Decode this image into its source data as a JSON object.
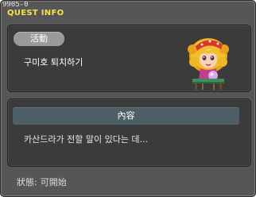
{
  "header": {
    "quest_id": "9905-0",
    "title": "QUEST INFO"
  },
  "quest": {
    "category_label": "活動",
    "name": "구미호 퇴치하기"
  },
  "content": {
    "section_label": "內容",
    "description": "카산드라가 전할 말이 있다는 데..."
  },
  "status": {
    "label": "狀態:",
    "value": "可開始"
  },
  "colors": {
    "title": "#f6e24a",
    "window_bg": "#565656",
    "panel_bg": "#3b3b3b",
    "header_bar": "#4e5e66"
  },
  "icons": {
    "npc_portrait": "npc-portrait-icon"
  }
}
